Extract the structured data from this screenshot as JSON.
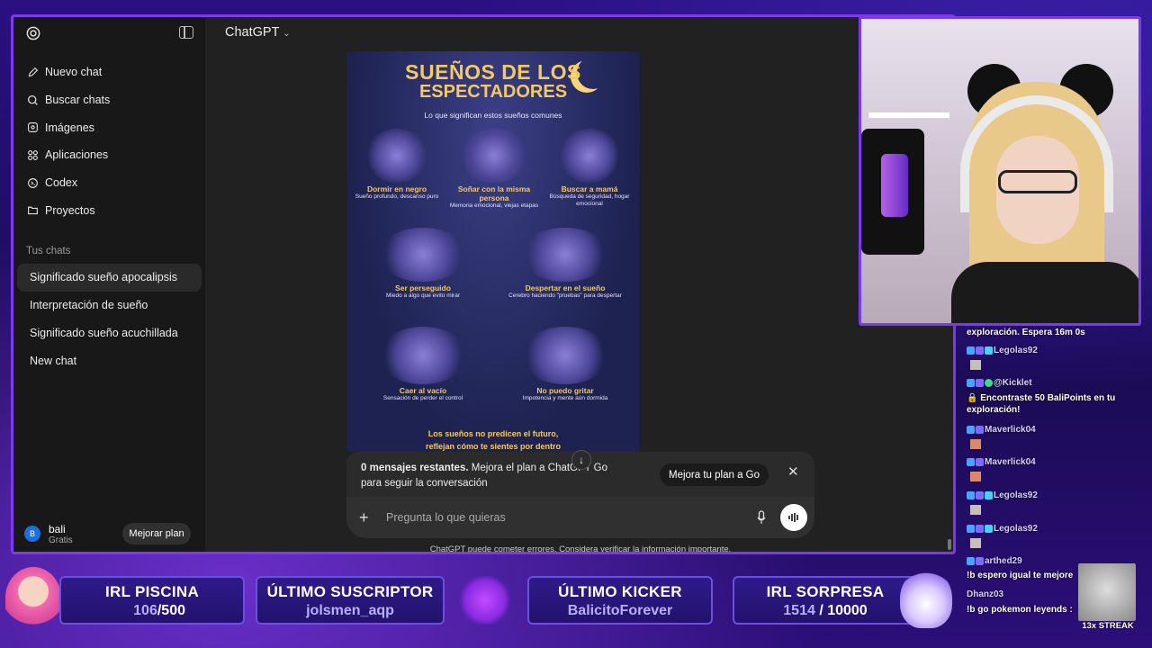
{
  "app": {
    "model_label": "ChatGPT",
    "sidebar": {
      "nav": [
        {
          "label": "Nuevo chat",
          "icon": "edit-icon"
        },
        {
          "label": "Buscar chats",
          "icon": "search-icon"
        },
        {
          "label": "Imágenes",
          "icon": "image-icon"
        },
        {
          "label": "Aplicaciones",
          "icon": "apps-icon"
        },
        {
          "label": "Codex",
          "icon": "codex-icon"
        },
        {
          "label": "Proyectos",
          "icon": "folder-icon"
        }
      ],
      "section_title": "Tus chats",
      "chats": [
        "Significado sueño apocalipsis",
        "Interpretación de sueño",
        "Significado sueño acuchillada",
        "New chat"
      ],
      "user": {
        "initial": "B",
        "name": "bali",
        "plan": "Gratis",
        "upgrade_label": "Mejorar plan"
      }
    },
    "image": {
      "title_1": "SUEÑOS DE LOS",
      "title_2": "ESPECTADORES",
      "subtitle": "Lo que significan estos sueños comunes",
      "cells": [
        {
          "title": "Dormir en negro",
          "desc": "Sueño profundo, descanso puro"
        },
        {
          "title": "Soñar con la misma persona",
          "desc": "Memoria emocional, viejas etapas"
        },
        {
          "title": "Buscar a mamá",
          "desc": "Búsqueda de seguridad, hogar emocional"
        },
        {
          "title": "Ser perseguido",
          "desc": "Miedo a algo que evito mirar"
        },
        {
          "title": "Despertar en el sueño",
          "desc": "Cerebro haciendo \"pruebas\" para despertar"
        },
        {
          "title": "Caer al vacío",
          "desc": "Sensación de perder el control"
        },
        {
          "title": "No puedo gritar",
          "desc": "Impotencia y mente aún dormida"
        }
      ],
      "footer_1": "Los sueños no predicen el futuro,",
      "footer_2": "reflejan cómo te sientes por dentro"
    },
    "limit": {
      "bold": "0 mensajes restantes.",
      "rest": " Mejora el plan a ChatGPT Go para seguir la conversación",
      "go_label": "Mejora tu plan a Go",
      "close": "✕"
    },
    "composer": {
      "placeholder": "Pregunta lo que quieras"
    },
    "disclaimer": "ChatGPT puede cometer errores. Considera verificar la información importante."
  },
  "chat_overlay": [
    {
      "text": "exploración. Espera 16m 0s",
      "top": 0
    },
    {
      "name": "Legolas92"
    },
    {
      "name": "@Kicklet"
    },
    {
      "text": "🔒 Encontraste 50 BaliPoints en tu exploración!"
    },
    {
      "name": "Maverlick04"
    },
    {
      "name": "Maverlick04"
    },
    {
      "name": "Legolas92"
    },
    {
      "name": "Legolas92"
    },
    {
      "name": "arthed29"
    },
    {
      "text": "!b espero igual te mejore"
    },
    {
      "name": "Dhanz03"
    },
    {
      "text": "!b go pokemon leyends :"
    }
  ],
  "streak": "13x STREAK",
  "panels": [
    {
      "title": "IRL PISCINA",
      "current": "106",
      "goal": "/500"
    },
    {
      "title": "ÚLTIMO SUSCRIPTOR",
      "value": "jolsmen_aqp"
    },
    {
      "title": "ÚLTIMO KICKER",
      "value": "BalicitoForever"
    },
    {
      "title": "IRL SORPRESA",
      "current": "1514",
      "goal": " / 10000"
    }
  ]
}
